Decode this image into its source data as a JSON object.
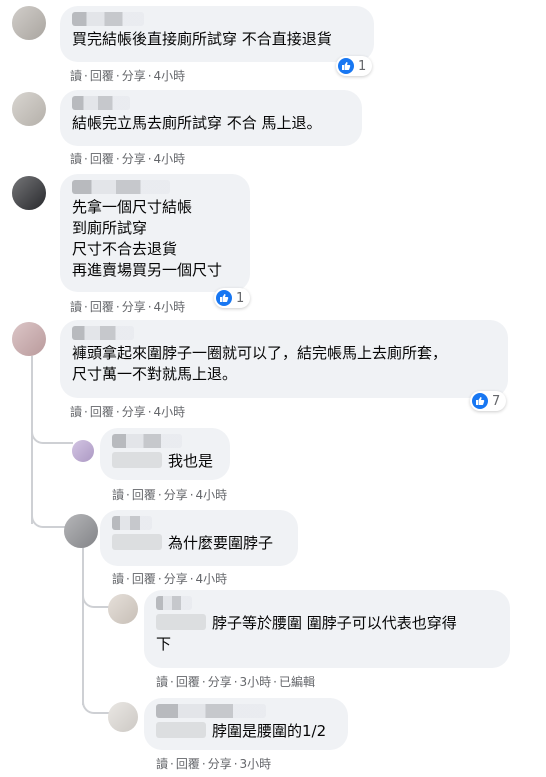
{
  "actions_text": {
    "read": "讀",
    "reply": "回覆",
    "share": "分享",
    "dot": "·",
    "edited": "已編輯"
  },
  "comments": [
    {
      "text": "買完結帳後直接廁所試穿 不合直接退貨",
      "time": "4小時",
      "likes": "1"
    },
    {
      "text": "結帳完立馬去廁所試穿 不合 馬上退。",
      "time": "4小時"
    },
    {
      "text": "先拿一個尺寸結帳\n到廁所試穿\n尺寸不合去退貨\n再進賣場買另一個尺寸",
      "time": "4小時",
      "likes": "1"
    },
    {
      "text": "褲頭拿起來圍脖子一圈就可以了，結完帳馬上去廁所套，\n尺寸萬一不對就馬上退。",
      "time": "4小時",
      "likes": "7"
    },
    {
      "text": "我也是",
      "time": "4小時"
    },
    {
      "text": "為什麼要圍脖子",
      "time": "4小時"
    },
    {
      "text": "脖子等於腰圍 圍脖子可以代表也穿得\n下",
      "time": "3小時"
    },
    {
      "text": "脖圍是腰圍的1/2",
      "time": "3小時"
    }
  ],
  "colors": {
    "bubble": "#f0f2f5",
    "secondary_text": "#65676b",
    "like_blue": "#1877f2"
  },
  "icons": [
    "like-icon",
    "avatar"
  ]
}
